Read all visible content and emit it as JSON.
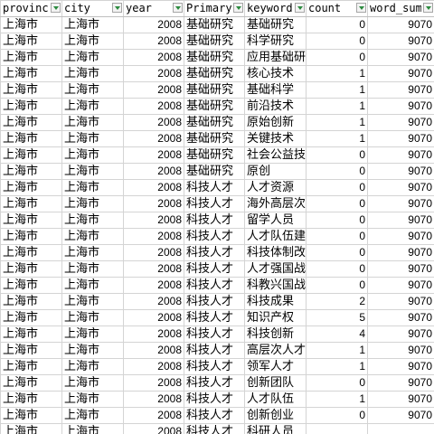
{
  "headers": [
    "province",
    "city",
    "year",
    "Primary",
    "keyword",
    "count",
    "word_sum"
  ],
  "rows": [
    [
      "上海市",
      "上海市",
      "2008",
      "基础研究",
      "基础研究",
      "0",
      "9070"
    ],
    [
      "上海市",
      "上海市",
      "2008",
      "基础研究",
      "科学研究",
      "0",
      "9070"
    ],
    [
      "上海市",
      "上海市",
      "2008",
      "基础研究",
      "应用基础研究",
      "0",
      "9070"
    ],
    [
      "上海市",
      "上海市",
      "2008",
      "基础研究",
      "核心技术",
      "1",
      "9070"
    ],
    [
      "上海市",
      "上海市",
      "2008",
      "基础研究",
      "基础科学",
      "1",
      "9070"
    ],
    [
      "上海市",
      "上海市",
      "2008",
      "基础研究",
      "前沿技术",
      "1",
      "9070"
    ],
    [
      "上海市",
      "上海市",
      "2008",
      "基础研究",
      "原始创新",
      "1",
      "9070"
    ],
    [
      "上海市",
      "上海市",
      "2008",
      "基础研究",
      "关键技术",
      "1",
      "9070"
    ],
    [
      "上海市",
      "上海市",
      "2008",
      "基础研究",
      "社会公益技术",
      "0",
      "9070"
    ],
    [
      "上海市",
      "上海市",
      "2008",
      "基础研究",
      "原创",
      "0",
      "9070"
    ],
    [
      "上海市",
      "上海市",
      "2008",
      "科技人才",
      "人才资源",
      "0",
      "9070"
    ],
    [
      "上海市",
      "上海市",
      "2008",
      "科技人才",
      "海外高层次",
      "0",
      "9070"
    ],
    [
      "上海市",
      "上海市",
      "2008",
      "科技人才",
      "留学人员",
      "0",
      "9070"
    ],
    [
      "上海市",
      "上海市",
      "2008",
      "科技人才",
      "人才队伍建设",
      "0",
      "9070"
    ],
    [
      "上海市",
      "上海市",
      "2008",
      "科技人才",
      "科技体制改革",
      "0",
      "9070"
    ],
    [
      "上海市",
      "上海市",
      "2008",
      "科技人才",
      "人才强国战略",
      "0",
      "9070"
    ],
    [
      "上海市",
      "上海市",
      "2008",
      "科技人才",
      "科教兴国战略",
      "0",
      "9070"
    ],
    [
      "上海市",
      "上海市",
      "2008",
      "科技人才",
      "科技成果",
      "2",
      "9070"
    ],
    [
      "上海市",
      "上海市",
      "2008",
      "科技人才",
      "知识产权",
      "5",
      "9070"
    ],
    [
      "上海市",
      "上海市",
      "2008",
      "科技人才",
      "科技创新",
      "4",
      "9070"
    ],
    [
      "上海市",
      "上海市",
      "2008",
      "科技人才",
      "高层次人才",
      "1",
      "9070"
    ],
    [
      "上海市",
      "上海市",
      "2008",
      "科技人才",
      "领军人才",
      "1",
      "9070"
    ],
    [
      "上海市",
      "上海市",
      "2008",
      "科技人才",
      "创新团队",
      "0",
      "9070"
    ],
    [
      "上海市",
      "上海市",
      "2008",
      "科技人才",
      "人才队伍",
      "1",
      "9070"
    ],
    [
      "上海市",
      "上海市",
      "2008",
      "科技人才",
      "创新创业",
      "0",
      "9070"
    ],
    [
      "上海市",
      "上海市",
      "2008",
      "科技人才",
      "科研人员",
      "",
      ""
    ]
  ]
}
